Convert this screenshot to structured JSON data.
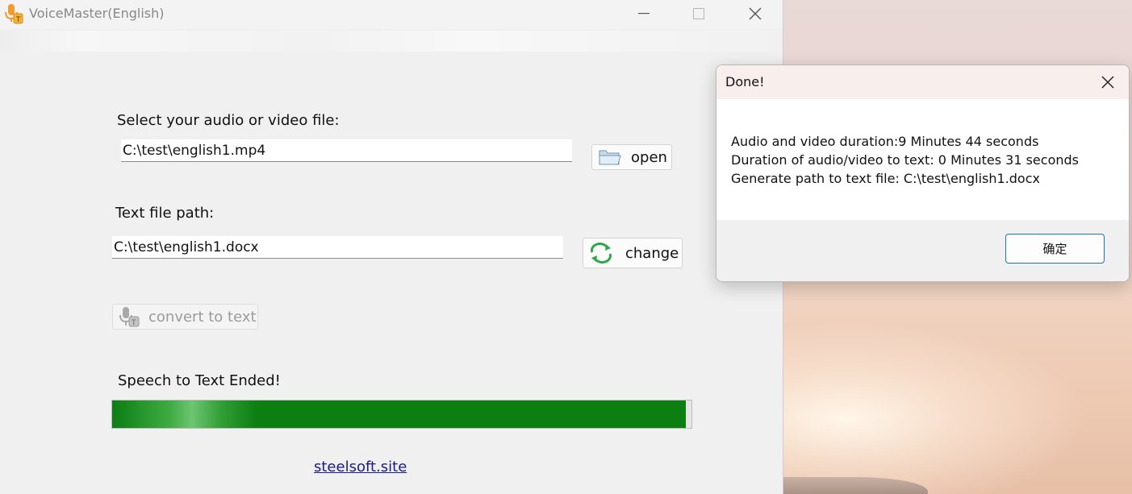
{
  "window": {
    "title": "VoiceMaster(English)"
  },
  "form": {
    "select_label": "Select your audio or video file:",
    "input_path": "C:\\test\\english1.mp4",
    "open_label": "open",
    "text_path_label": "Text file path:",
    "output_path": "C:\\test\\english1.docx",
    "change_label": "change",
    "convert_label": "convert to text",
    "status_text": "Speech to Text Ended!",
    "progress": 0.99
  },
  "footer": {
    "link_text": "steelsoft.site"
  },
  "dialog": {
    "title": "Done!",
    "lines": [
      "Audio and video duration:9 Minutes 44 seconds",
      "Duration of audio/video to text: 0 Minutes 31 seconds",
      "Generate path to text file: C:\\test\\english1.docx"
    ],
    "ok_label": "确定"
  },
  "colors": {
    "progress_fill": "#0c7e12",
    "accent": "#1f6fc5",
    "link": "#1a1a8c"
  },
  "icons": {
    "app": "microphone-app-icon",
    "open": "folder-icon",
    "change": "refresh-arrows-icon",
    "convert": "microphone-text-icon",
    "close": "close-icon"
  }
}
